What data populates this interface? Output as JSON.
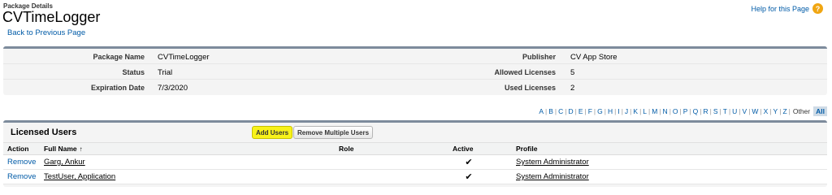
{
  "header": {
    "subtitle": "Package Details",
    "title": "CVTimeLogger",
    "back_link": "Back to Previous Page",
    "help_link": "Help for this Page",
    "help_icon": "?"
  },
  "details": {
    "rows": [
      {
        "left_label": "Package Name",
        "left_value": "CVTimeLogger",
        "right_label": "Publisher",
        "right_value": "CV App Store"
      },
      {
        "left_label": "Status",
        "left_value": "Trial",
        "right_label": "Allowed Licenses",
        "right_value": "5"
      },
      {
        "left_label": "Expiration Date",
        "left_value": "7/3/2020",
        "right_label": "Used Licenses",
        "right_value": "2"
      }
    ]
  },
  "alpha_filter": {
    "letters": [
      "A",
      "B",
      "C",
      "D",
      "E",
      "F",
      "G",
      "H",
      "I",
      "J",
      "K",
      "L",
      "M",
      "N",
      "O",
      "P",
      "Q",
      "R",
      "S",
      "T",
      "U",
      "V",
      "W",
      "X",
      "Y",
      "Z"
    ],
    "other": "Other",
    "all": "All"
  },
  "licensed_users": {
    "title": "Licensed Users",
    "add_button": "Add Users",
    "remove_multiple_button": "Remove Multiple Users",
    "columns": {
      "action": "Action",
      "full_name": "Full Name",
      "sort_arrow": "↑",
      "role": "Role",
      "active": "Active",
      "profile": "Profile"
    },
    "rows": [
      {
        "action": "Remove",
        "full_name": "Garg, Ankur",
        "role": "",
        "active": "✔",
        "profile": "System Administrator"
      },
      {
        "action": "Remove",
        "full_name": "TestUser, Application",
        "role": "",
        "active": "✔",
        "profile": "System Administrator"
      }
    ]
  },
  "colors": {
    "accent_link": "#015ba7",
    "add_button": "#f8f21a",
    "help_icon": "#f0a612",
    "panel_border": "#7d8b9c"
  }
}
